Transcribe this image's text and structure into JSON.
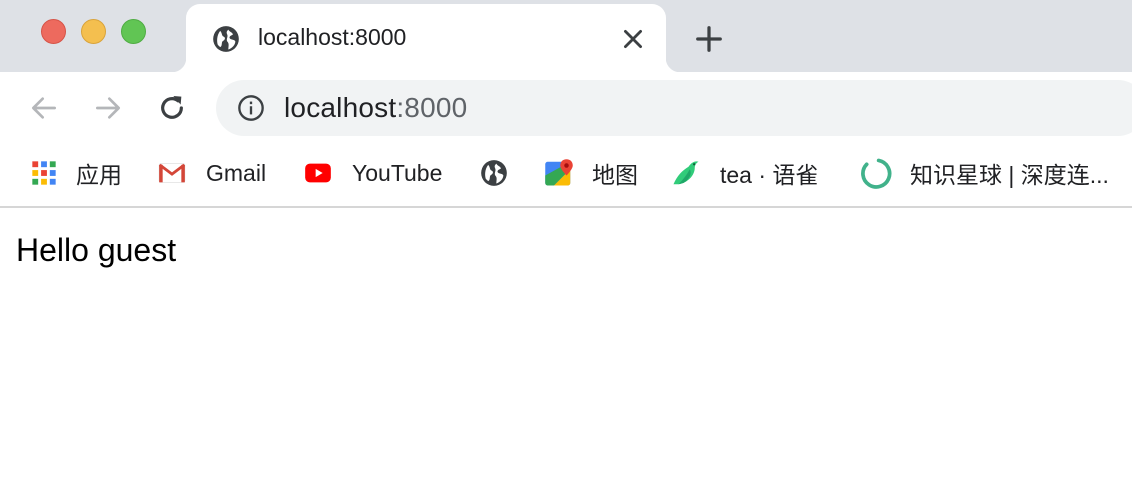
{
  "window": {
    "controls": [
      "close",
      "minimize",
      "maximize"
    ],
    "colors": {
      "close": "#ed6a5e",
      "minimize": "#f4bf4f",
      "maximize": "#61c554"
    }
  },
  "tab": {
    "title": "localhost:8000",
    "favicon": "globe-icon",
    "close_icon": "close-icon"
  },
  "new_tab_icon": "plus-icon",
  "toolbar": {
    "back_icon": "arrow-left-icon",
    "forward_icon": "arrow-right-icon",
    "reload_icon": "reload-icon",
    "omnibox": {
      "security_icon": "info-icon",
      "host": "localhost",
      "port": ":8000"
    }
  },
  "bookmarks": [
    {
      "label": "应用",
      "icon": "apps-grid-icon"
    },
    {
      "label": "Gmail",
      "icon": "gmail-icon"
    },
    {
      "label": "YouTube",
      "icon": "youtube-icon"
    },
    {
      "label": "",
      "icon": "globe-icon"
    },
    {
      "label": "地图",
      "icon": "maps-icon"
    },
    {
      "label": "tea · 语雀",
      "icon": "yuque-bird-icon"
    },
    {
      "label": "知识星球 | 深度连...",
      "icon": "zsxq-ring-icon"
    }
  ],
  "page": {
    "greeting": "Hello guest"
  }
}
